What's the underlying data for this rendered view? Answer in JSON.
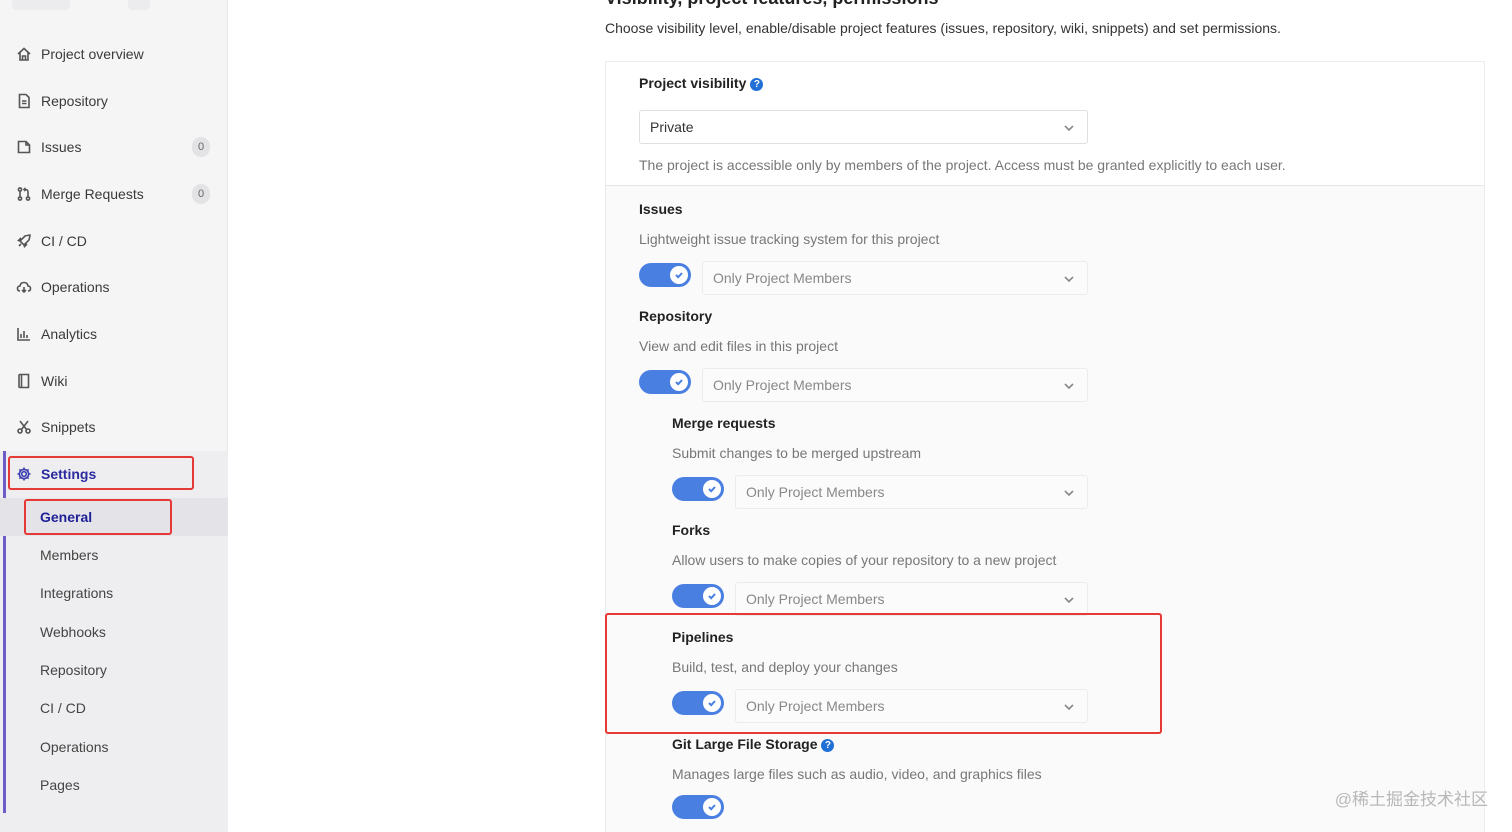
{
  "sidebar": {
    "items": [
      {
        "label": "Project overview",
        "icon": "home-icon"
      },
      {
        "label": "Repository",
        "icon": "document-icon"
      },
      {
        "label": "Issues",
        "icon": "issues-icon",
        "count": "0"
      },
      {
        "label": "Merge Requests",
        "icon": "merge-request-icon",
        "count": "0"
      },
      {
        "label": "CI / CD",
        "icon": "rocket-icon"
      },
      {
        "label": "Operations",
        "icon": "cloud-icon"
      },
      {
        "label": "Analytics",
        "icon": "chart-icon"
      },
      {
        "label": "Wiki",
        "icon": "book-icon"
      },
      {
        "label": "Snippets",
        "icon": "scissors-icon"
      }
    ],
    "settings": {
      "label": "Settings",
      "icon": "gear-icon"
    },
    "settings_sub": [
      "General",
      "Members",
      "Integrations",
      "Webhooks",
      "Repository",
      "CI / CD",
      "Operations",
      "Pages"
    ]
  },
  "main": {
    "cut_heading": "Visibility, project features, permissions",
    "intro": "Choose visibility level, enable/disable project features (issues, repository, wiki, snippets) and set permissions.",
    "visibility": {
      "label": "Project visibility",
      "value": "Private",
      "help": "The project is accessible only by members of the project. Access must be granted explicitly to each user."
    },
    "features": [
      {
        "label": "Issues",
        "help": "Lightweight issue tracking system for this project",
        "value": "Only Project Members"
      },
      {
        "label": "Repository",
        "help": "View and edit files in this project",
        "value": "Only Project Members"
      },
      {
        "label": "Merge requests",
        "help": "Submit changes to be merged upstream",
        "value": "Only Project Members"
      },
      {
        "label": "Forks",
        "help": "Allow users to make copies of your repository to a new project",
        "value": "Only Project Members"
      },
      {
        "label": "Pipelines",
        "help": "Build, test, and deploy your changes",
        "value": "Only Project Members"
      },
      {
        "label": "Git Large File Storage",
        "help": "Manages large files such as audio, video, and graphics files"
      }
    ]
  },
  "watermark": "@稀土掘金技术社区",
  "colors": {
    "accent": "#4a7fe2",
    "highlight": "#e53935",
    "active_nav": "#2a2aa0"
  }
}
